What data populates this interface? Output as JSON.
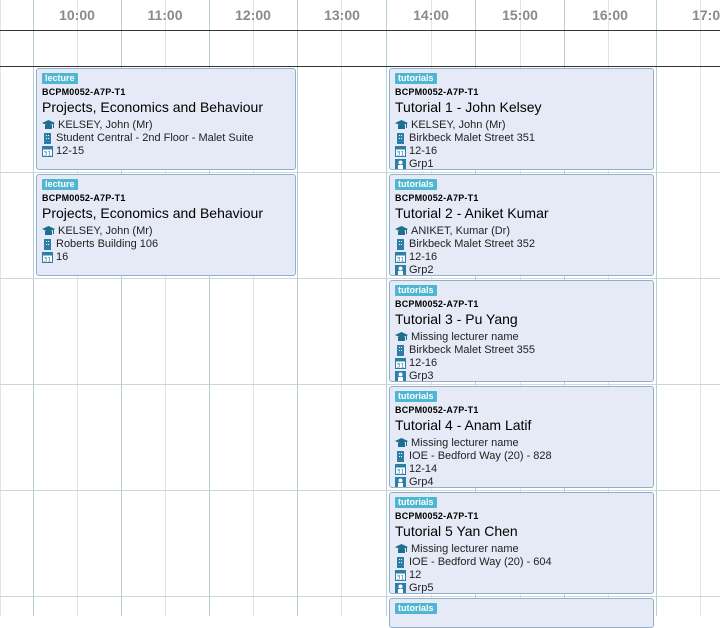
{
  "header": {
    "times": [
      "10:00",
      "11:00",
      "12:00",
      "13:00",
      "14:00",
      "15:00",
      "16:00",
      "17:00"
    ]
  },
  "events": [
    {
      "tag": "lecture",
      "code": "BCPM0052-A7P-T1",
      "title": "Projects, Economics and Behaviour",
      "lecturer": "KELSEY, John (Mr)",
      "location": "Student Central - 2nd Floor - Malet Suite",
      "weeks": "12-15"
    },
    {
      "tag": "lecture",
      "code": "BCPM0052-A7P-T1",
      "title": "Projects, Economics and Behaviour",
      "lecturer": "KELSEY, John (Mr)",
      "location": "Roberts Building 106",
      "weeks": "16"
    },
    {
      "tag": "tutorials",
      "code": "BCPM0052-A7P-T1",
      "title": "Tutorial 1 - John Kelsey",
      "lecturer": "KELSEY, John (Mr)",
      "location": "Birkbeck Malet Street 351",
      "weeks": "12-16",
      "group": "Grp1"
    },
    {
      "tag": "tutorials",
      "code": "BCPM0052-A7P-T1",
      "title": "Tutorial 2 - Aniket Kumar",
      "lecturer": "ANIKET, Kumar (Dr)",
      "location": "Birkbeck Malet Street 352",
      "weeks": "12-16",
      "group": "Grp2"
    },
    {
      "tag": "tutorials",
      "code": "BCPM0052-A7P-T1",
      "title": "Tutorial 3 - Pu Yang",
      "lecturer": "Missing lecturer name",
      "location": "Birkbeck Malet Street 355",
      "weeks": "12-16",
      "group": "Grp3"
    },
    {
      "tag": "tutorials",
      "code": "BCPM0052-A7P-T1",
      "title": "Tutorial 4 - Anam Latif",
      "lecturer": "Missing lecturer name",
      "location": "IOE - Bedford Way (20) - 828",
      "weeks": "12-14",
      "group": "Grp4"
    },
    {
      "tag": "tutorials",
      "code": "BCPM0052-A7P-T1",
      "title": "Tutorial 5 Yan Chen",
      "lecturer": "Missing lecturer name",
      "location": "IOE - Bedford Way (20) - 604",
      "weeks": "12",
      "group": "Grp5"
    },
    {
      "tag": "tutorials"
    }
  ],
  "icons": {
    "lecturer": "lecturer-cap-icon",
    "location": "building-icon",
    "weeks": "calendar-icon",
    "group": "group-icon"
  },
  "colors": {
    "event_bg": "#e6eaf6",
    "event_border": "#8fb1c9",
    "tag_bg": "#4fb6d2"
  }
}
